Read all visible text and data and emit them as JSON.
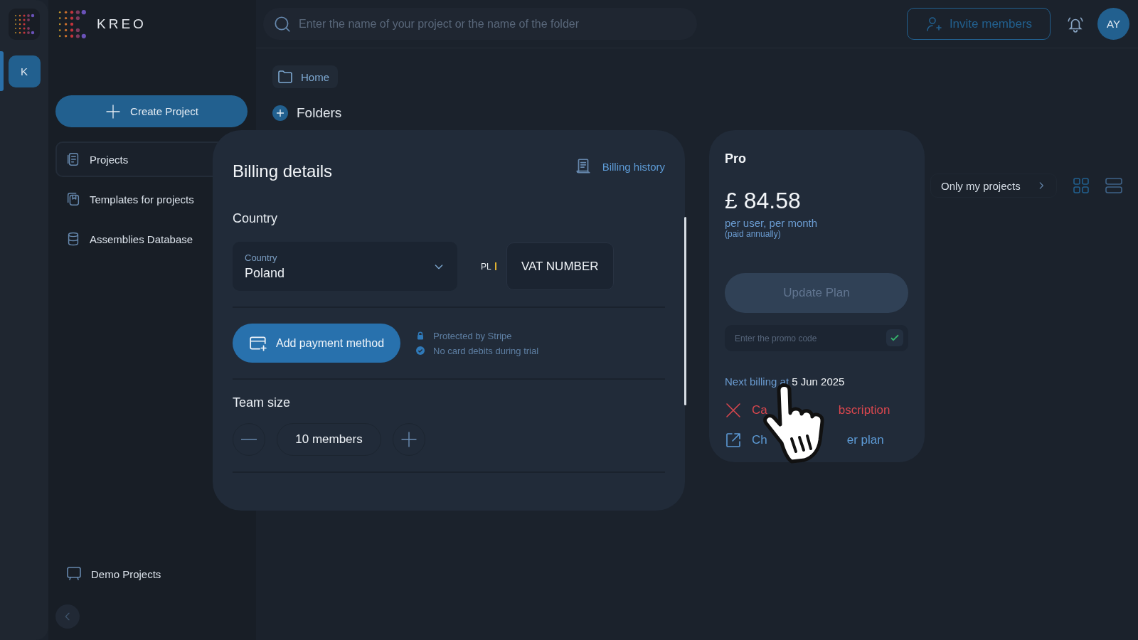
{
  "logo": {
    "wordmark": "KREO"
  },
  "workspaces": [
    {
      "initial": "K",
      "selected": true
    }
  ],
  "sidebar": {
    "create_button": "Create Project",
    "items": [
      {
        "kind": "projects",
        "label": "Projects",
        "selected": true
      },
      {
        "kind": "templates",
        "label": "Templates for projects",
        "selected": false
      },
      {
        "kind": "database",
        "label": "Assemblies Database",
        "selected": false
      }
    ],
    "bottom_items": [
      {
        "kind": "demo",
        "label": "Demo Projects"
      }
    ]
  },
  "search": {
    "placeholder": "Enter the name of your project or the name of the folder"
  },
  "header": {
    "invite_button": "Invite members",
    "avatar": "AY"
  },
  "breadcrumb": {
    "label": "Home"
  },
  "folders": {
    "title": "Folders"
  },
  "filter": {
    "label": "Only my projects"
  },
  "billing": {
    "title": "Billing details",
    "history_link": "Billing history",
    "country_heading": "Country",
    "country_select": {
      "label": "Country",
      "value": "Poland"
    },
    "vat_prefix": "PL",
    "vat_field": {
      "value": "VAT NUMBER"
    },
    "add_payment": "Add payment method",
    "notes": [
      {
        "kind": "lock",
        "text": "Protected by Stripe"
      },
      {
        "kind": "check",
        "text": "No card debits during trial"
      }
    ],
    "team_heading": "Team size",
    "team_count": "10 members"
  },
  "plan": {
    "name": "Pro",
    "price": "£ 84.58",
    "period": "per user, per month",
    "billing_note": "(paid annually)",
    "update_button": {
      "label": "Update Plan",
      "disabled": true
    },
    "promo": {
      "placeholder": "Enter the promo code"
    },
    "next_billing": "Next billing at **5 Jun 2025**",
    "actions": [
      {
        "kind": "cancel",
        "parts": [
          "Ca",
          "bscription"
        ]
      },
      {
        "kind": "change",
        "parts": [
          "Ch",
          "er plan"
        ]
      }
    ]
  }
}
